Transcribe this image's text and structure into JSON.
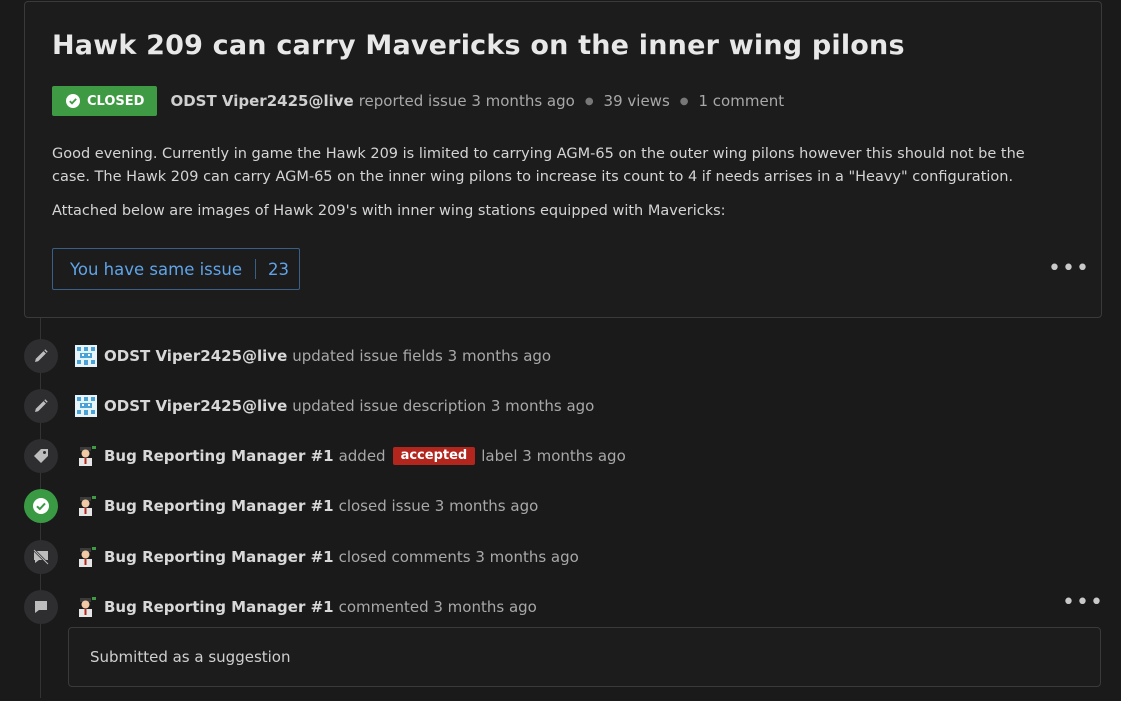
{
  "issue": {
    "title": "Hawk 209 can carry Mavericks on the inner wing pilons",
    "status": "CLOSED",
    "author": "ODST Viper2425@live",
    "action": "reported issue 3 months ago",
    "views": "39 views",
    "comments": "1 comment",
    "body_p1": "Good evening. Currently in game the Hawk 209 is limited to carrying AGM-65 on the outer wing pilons however this should not be the case. The Hawk 209 can carry AGM-65 on the inner wing pilons to increase its count to 4 if needs arrises in a \"Heavy\" configuration.",
    "body_p2": "Attached below are images of Hawk 209's with inner wing stations equipped with Mavericks:",
    "same_issue_label": "You have same issue",
    "same_issue_count": "23",
    "more": "•••"
  },
  "timeline": [
    {
      "icon": "pencil-icon",
      "avatar": "pixel-avatar",
      "actor": "ODST Viper2425@live",
      "text": "updated issue fields 3 months ago"
    },
    {
      "icon": "pencil-icon",
      "avatar": "pixel-avatar",
      "actor": "ODST Viper2425@live",
      "text": "updated issue description 3 months ago"
    },
    {
      "icon": "tag-icon",
      "avatar": "manager-avatar",
      "actor": "Bug Reporting Manager #1",
      "pre": "added",
      "label": "accepted",
      "post": "label 3 months ago"
    },
    {
      "icon": "check-circle-icon",
      "avatar": "manager-avatar",
      "actor": "Bug Reporting Manager #1",
      "text": "closed issue 3 months ago"
    },
    {
      "icon": "comments-closed-icon",
      "avatar": "manager-avatar",
      "actor": "Bug Reporting Manager #1",
      "text": "closed comments 3 months ago"
    },
    {
      "icon": "comment-icon",
      "avatar": "manager-avatar",
      "actor": "Bug Reporting Manager #1",
      "text": "commented 3 months ago"
    }
  ],
  "comment": {
    "text": "Submitted as a suggestion",
    "more": "•••"
  },
  "colors": {
    "closed_badge": "#3f9a44",
    "accepted_label": "#b3261e",
    "link_blue": "#5fa4e8"
  }
}
